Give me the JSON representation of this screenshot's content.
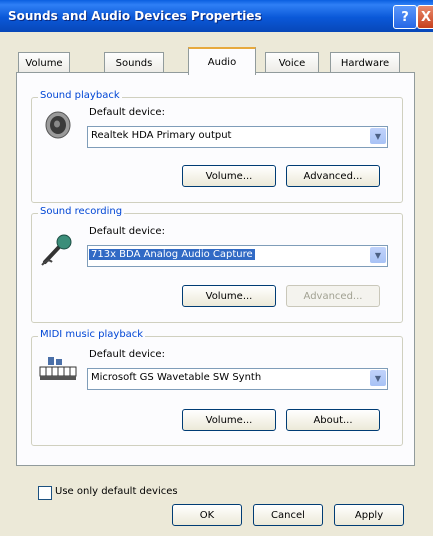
{
  "window": {
    "title": "Sounds and Audio Devices Properties",
    "help_label": "?",
    "close_label": "X"
  },
  "tabs": [
    {
      "label": "Volume"
    },
    {
      "label": "Sounds"
    },
    {
      "label": "Audio"
    },
    {
      "label": "Voice"
    },
    {
      "label": "Hardware"
    }
  ],
  "active_tab": "Audio",
  "playback": {
    "title": "Sound playback",
    "default_label": "Default device:",
    "device": "Realtek HDA Primary output",
    "volume_label": "Volume...",
    "advanced_label": "Advanced..."
  },
  "recording": {
    "title": "Sound recording",
    "default_label": "Default device:",
    "device": "713x BDA Analog Audio Capture",
    "volume_label": "Volume...",
    "advanced_label": "Advanced..."
  },
  "midi": {
    "title": "MIDI music playback",
    "default_label": "Default device:",
    "device": "Microsoft GS Wavetable SW Synth",
    "volume_label": "Volume...",
    "about_label": "About..."
  },
  "use_default_label": "Use only default devices",
  "use_default_checked": false,
  "footer": {
    "ok_label": "OK",
    "cancel_label": "Cancel",
    "apply_label": "Apply"
  },
  "icons": {
    "playback": "speaker-icon",
    "recording": "microphone-icon",
    "midi": "midi-keyboard-icon",
    "dropdown": "chevron-down-icon"
  },
  "colors": {
    "titlebar": "#0a58d8",
    "group_title": "#0046d5",
    "selection": "#316ac5",
    "tab_highlight": "#e7a93d"
  }
}
